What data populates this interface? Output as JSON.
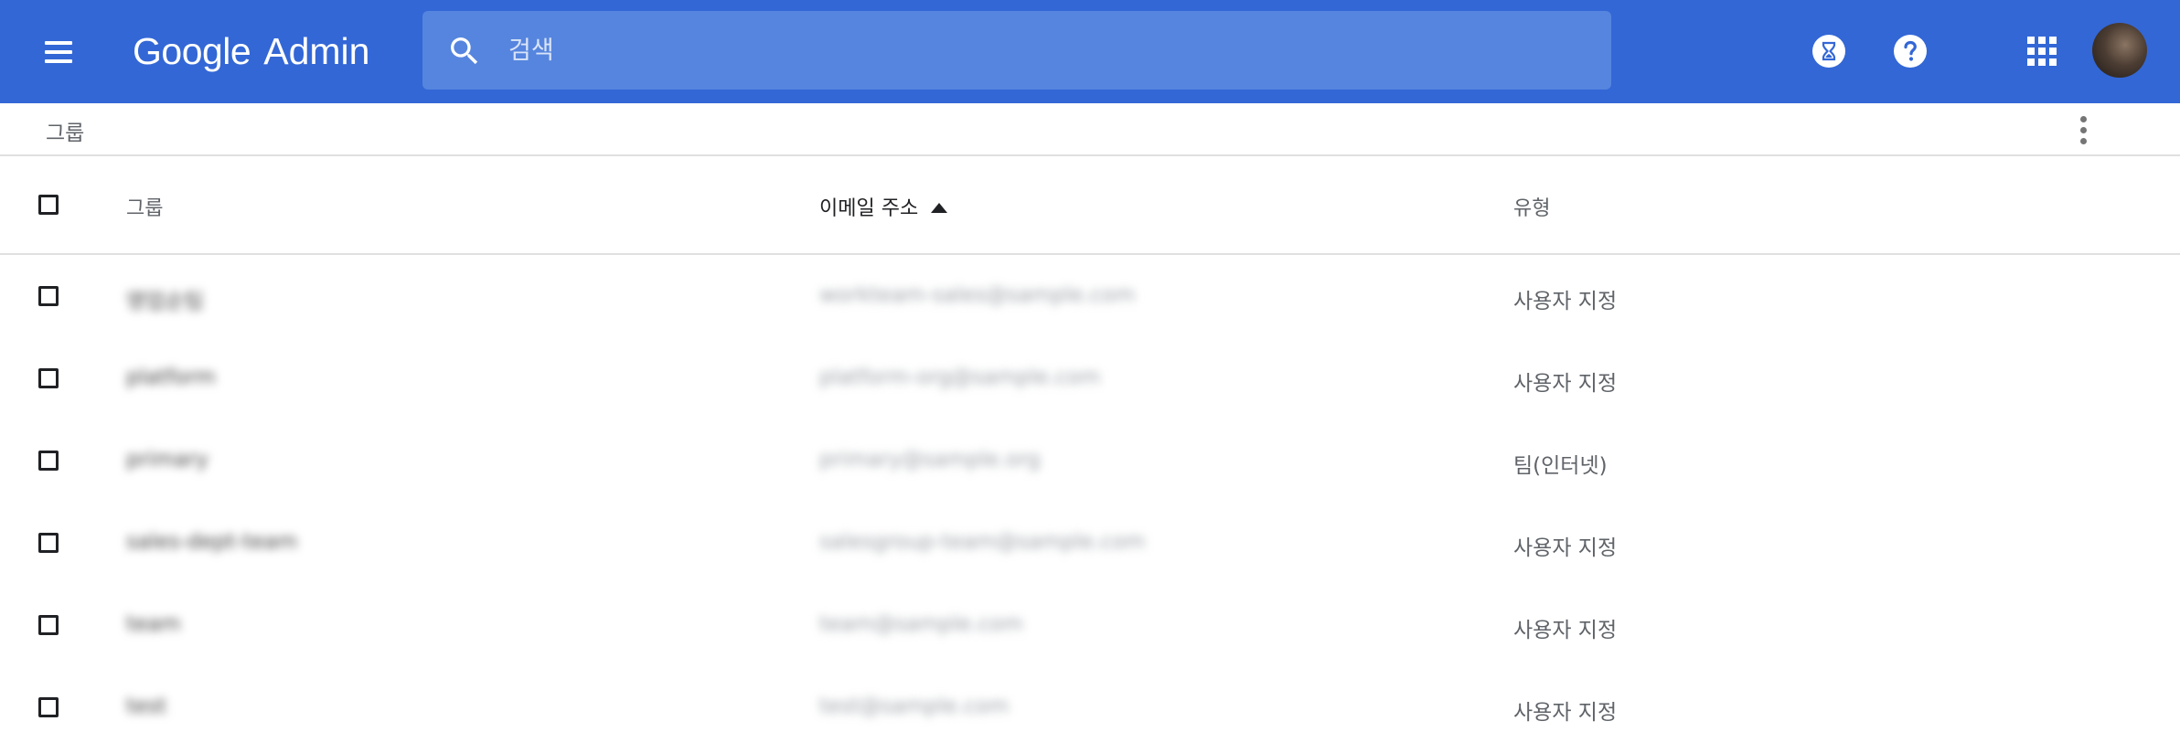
{
  "appbar": {
    "brand": "Google",
    "product": "Admin",
    "search_placeholder": "검색"
  },
  "subheader": {
    "breadcrumb": "그룹"
  },
  "table": {
    "headers": {
      "group": "그룹",
      "email": "이메일 주소",
      "type": "유형"
    },
    "sort": {
      "column": "email",
      "direction": "ascending"
    },
    "rows": [
      {
        "group": "영업순팀",
        "email": "workteam-sales@sample.com",
        "type": "사용자 지정"
      },
      {
        "group": "platform",
        "email": "platform-org@sample.com",
        "type": "사용자 지정"
      },
      {
        "group": "primary",
        "email": "primary@sample.org",
        "type": "팀(인터넷)"
      },
      {
        "group": "sales-dept-team",
        "email": "salesgroup-team@sample.com",
        "type": "사용자 지정"
      },
      {
        "group": "team",
        "email": "team@sample.com",
        "type": "사용자 지정"
      },
      {
        "group": "test",
        "email": "test@sample.com",
        "type": "사용자 지정"
      }
    ]
  },
  "colors": {
    "appbar": "#3367d6",
    "search_bg": "#5585de",
    "divider": "#e0e0e0"
  }
}
